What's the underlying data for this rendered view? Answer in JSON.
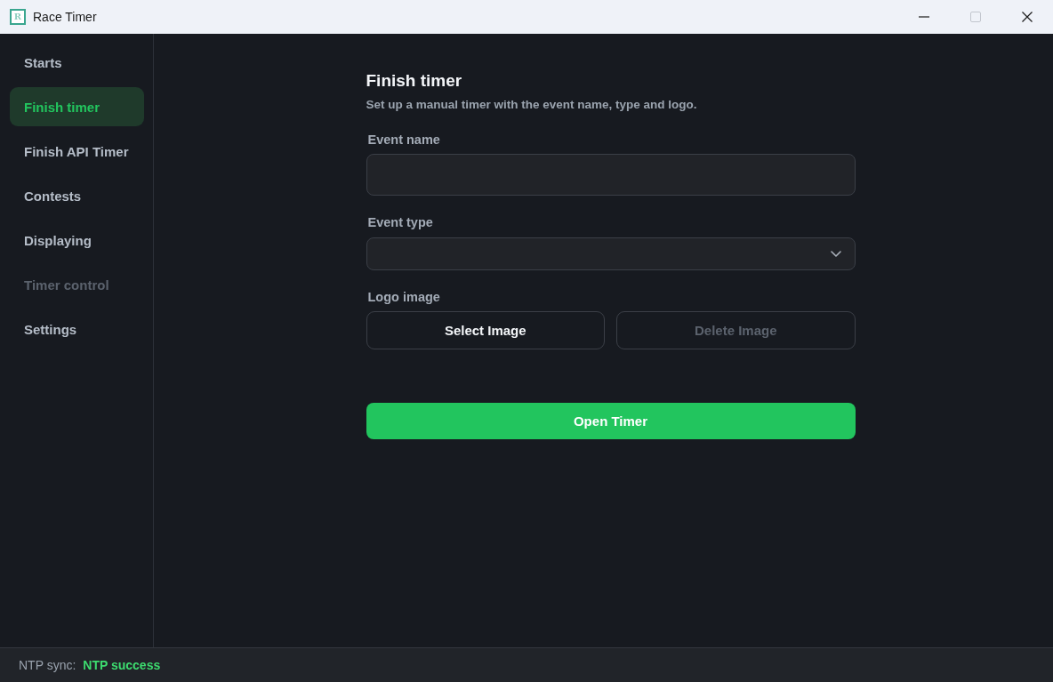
{
  "window": {
    "title": "Race Timer",
    "logo_text": "R",
    "controls": [
      {
        "kind": "minimize",
        "disabled": false
      },
      {
        "kind": "maximize",
        "disabled": true
      },
      {
        "kind": "close",
        "disabled": false
      }
    ]
  },
  "sidebar": {
    "items": [
      {
        "label": "Starts",
        "selected": false,
        "disabled": false
      },
      {
        "label": "Finish timer",
        "selected": true,
        "disabled": false
      },
      {
        "label": "Finish API Timer",
        "selected": false,
        "disabled": false
      },
      {
        "label": "Contests",
        "selected": false,
        "disabled": false
      },
      {
        "label": "Displaying",
        "selected": false,
        "disabled": false
      },
      {
        "label": "Timer control",
        "selected": false,
        "disabled": true
      },
      {
        "label": "Settings",
        "selected": false,
        "disabled": false
      }
    ]
  },
  "form": {
    "title": "Finish timer",
    "subtitle": "Set up a manual timer with the event name, type and logo.",
    "fields": [
      {
        "label": "Event name",
        "kind": "text"
      },
      {
        "label": "Event type",
        "kind": "select"
      }
    ],
    "logo": {
      "label": "Logo image",
      "buttons": [
        {
          "label": "Select Image",
          "disabled": false
        },
        {
          "label": "Delete Image",
          "disabled": true
        }
      ]
    },
    "submit": {
      "label": "Open Timer"
    }
  },
  "status_bar": {
    "label": "NTP sync:",
    "value": "NTP success",
    "kind": "success"
  }
}
